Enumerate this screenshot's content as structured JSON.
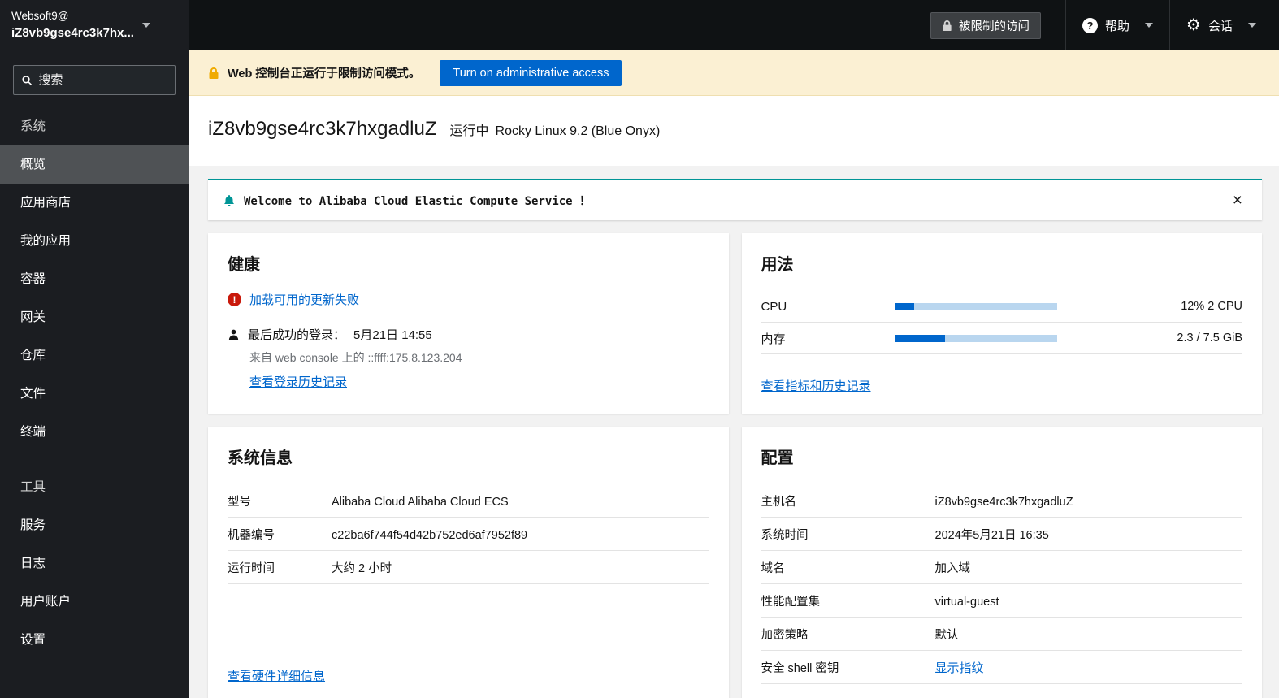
{
  "masthead": {
    "brand_line1": "Websoft9@",
    "brand_line2": "iZ8vb9gse4rc3k7hx...",
    "limited_access_label": "被限制的访问",
    "help_label": "帮助",
    "session_label": "会话"
  },
  "sidebar": {
    "search_placeholder": "搜索",
    "section_system": "系统",
    "section_tools": "工具",
    "system_items": [
      "概览",
      "应用商店",
      "我的应用",
      "容器",
      "网关",
      "仓库",
      "文件",
      "终端"
    ],
    "tool_items": [
      "服务",
      "日志",
      "用户账户",
      "设置"
    ],
    "active_item": "概览"
  },
  "banner": {
    "message": "Web 控制台正运行于限制访问模式。",
    "action_label": "Turn on administrative access"
  },
  "page": {
    "hostname": "iZ8vb9gse4rc3k7hxgadluZ",
    "state": "运行中",
    "os": "Rocky Linux 9.2 (Blue Onyx)"
  },
  "alert": {
    "message": "Welcome to Alibaba Cloud Elastic Compute Service ！",
    "close_label": "×"
  },
  "health_card": {
    "title": "健康",
    "updates_error_link": "加载可用的更新失败",
    "last_login_label": "最后成功的登录：",
    "last_login_time": "5月21日 14:55",
    "login_origin": "来自 web console 上的 ::ffff:175.8.123.204",
    "login_history_link": "查看登录历史记录"
  },
  "usage_card": {
    "title": "用法",
    "rows": [
      {
        "label": "CPU",
        "value": "12% 2 CPU",
        "percent": 12
      },
      {
        "label": "内存",
        "value": "2.3 / 7.5 GiB",
        "percent": 31
      }
    ],
    "metrics_link": "查看指标和历史记录"
  },
  "system_info_card": {
    "title": "系统信息",
    "rows": [
      {
        "label": "型号",
        "value": "Alibaba Cloud Alibaba Cloud ECS"
      },
      {
        "label": "机器编号",
        "value": "c22ba6f744f54d42b752ed6af7952f89"
      },
      {
        "label": "运行时间",
        "value": "大约 2 小时"
      }
    ],
    "hardware_link": "查看硬件详细信息"
  },
  "config_card": {
    "title": "配置",
    "rows": [
      {
        "label": "主机名",
        "value": "iZ8vb9gse4rc3k7hxgadluZ"
      },
      {
        "label": "系统时间",
        "value": "2024年5月21日 16:35"
      },
      {
        "label": "域名",
        "value": "加入域"
      },
      {
        "label": "性能配置集",
        "value": "virtual-guest"
      },
      {
        "label": "加密策略",
        "value": "默认"
      },
      {
        "label": "安全 shell 密钥",
        "value": "显示指纹"
      }
    ]
  },
  "colors": {
    "accent_blue": "#0066cc",
    "warning_gold": "#f0ab00",
    "danger_red": "#c9190b",
    "alert_teal": "#009596"
  }
}
